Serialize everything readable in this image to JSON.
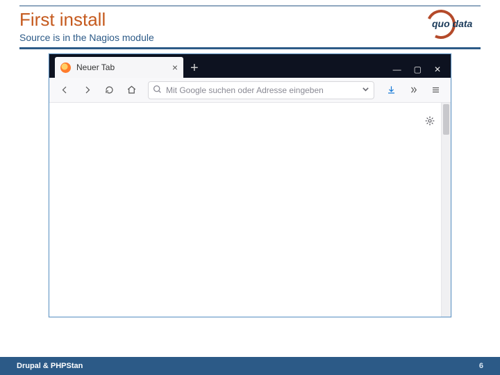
{
  "header": {
    "title": "First install",
    "subtitle": "Source is in the Nagios module"
  },
  "logo": {
    "text": "quo data"
  },
  "browser": {
    "tab_title": "Neuer Tab",
    "url_placeholder": "Mit Google suchen oder Adresse eingeben"
  },
  "footer": {
    "text": "Drupal & PHPStan",
    "page": "6"
  }
}
